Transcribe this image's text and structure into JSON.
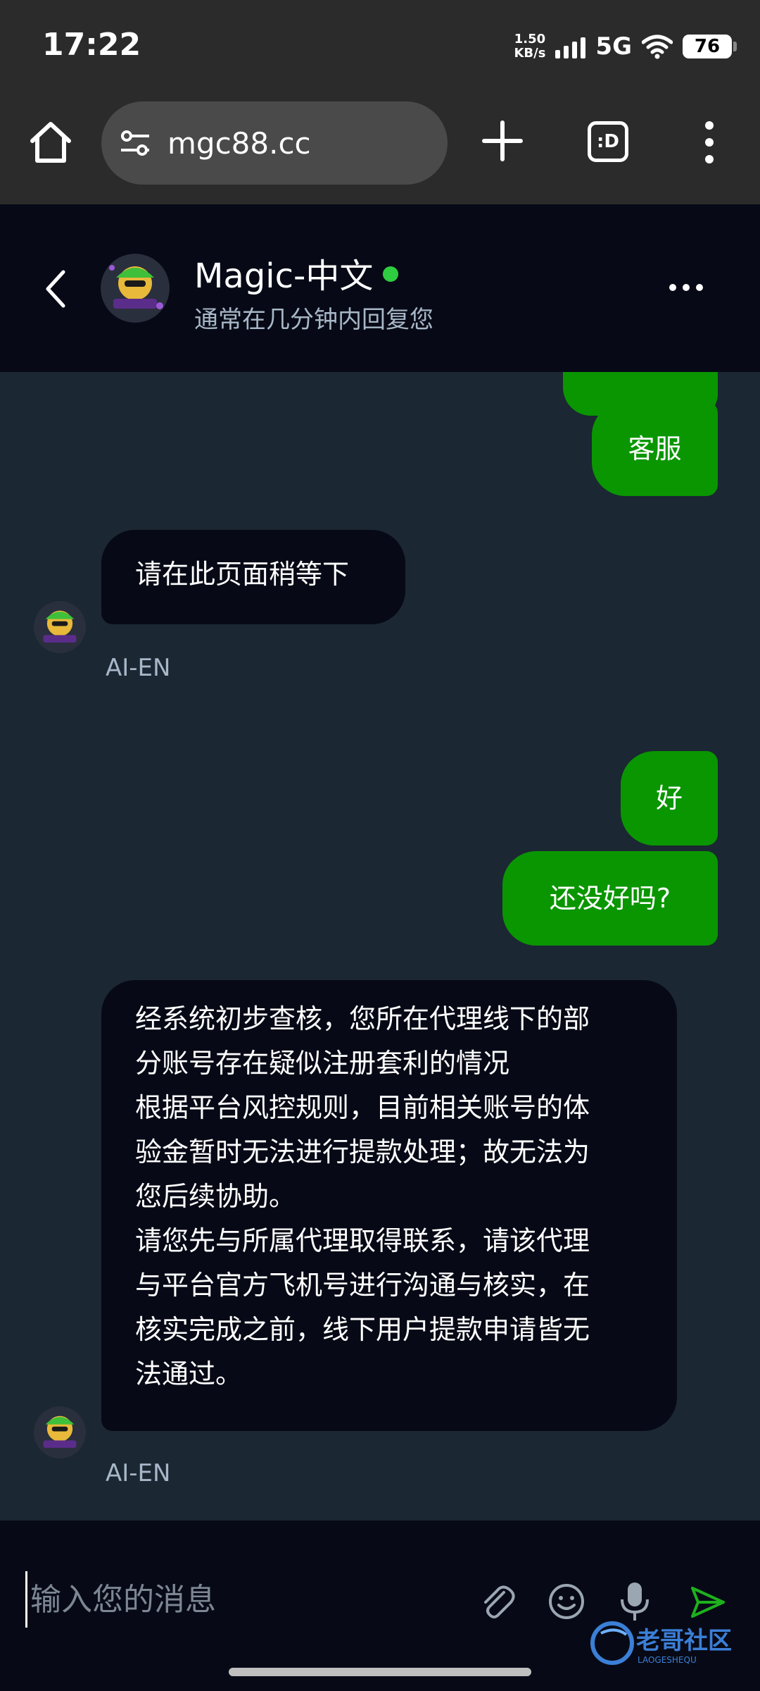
{
  "status_bar": {
    "time": "17:22",
    "net_speed_value": "1.50",
    "net_speed_unit": "KB/s",
    "network": "5G",
    "battery": "76"
  },
  "browser": {
    "url": "mgc88.cc",
    "tabs_label": ":D"
  },
  "chat_header": {
    "title": "Magic-中文",
    "subtitle": "通常在几分钟内回复您",
    "online_color": "#2ecc40"
  },
  "messages": {
    "out_1": "客服",
    "in_1": "请在此页面稍等下",
    "in_1_sender": "AI-EN",
    "out_2": "好",
    "out_3": "还没好吗?",
    "in_2_lines": [
      "经系统初步查核，您所在代理线下的部",
      "分账号存在疑似注册套利的情况",
      "根据平台风控规则，目前相关账号的体",
      "验金暂时无法进行提款处理；故无法为",
      "您后续协助。",
      "请您先与所属代理取得联系，请该代理",
      "与平台官方飞机号进行沟通与核实，在",
      "核实完成之前，线下用户提款申请皆无",
      "法通过。"
    ],
    "in_2_sender": "AI-EN"
  },
  "composer": {
    "placeholder": "输入您的消息"
  },
  "colors": {
    "outgoing_bubble": "#0a9600",
    "incoming_bubble": "#070a16",
    "chat_background": "#1b2733",
    "send_icon": "#1db11d"
  },
  "watermark": {
    "text": "老哥社区",
    "subtext": "LAOGESHEQU"
  }
}
